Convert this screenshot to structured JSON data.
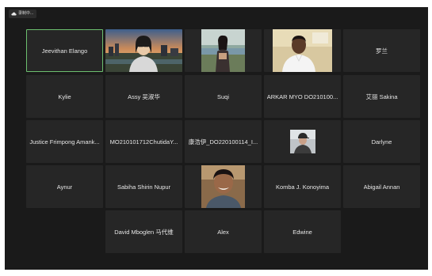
{
  "recording": {
    "label": "录制中...",
    "icon": "cloud-icon"
  },
  "colors": {
    "window_bg": "#1a1a1a",
    "tile_bg": "#262626",
    "active_speaker_border": "#6cbf6f",
    "name_text": "#e6e6e6"
  },
  "participants": [
    {
      "name": "Jeevithan Elango",
      "active": true,
      "video": false
    },
    {
      "name": "",
      "video": true,
      "video_desc": "woman-with-city-sunset-background"
    },
    {
      "name": "",
      "video": true,
      "video_desc": "person-outdoors-by-water"
    },
    {
      "name": "",
      "video": true,
      "video_desc": "man-in-white-shirt-indoors"
    },
    {
      "name": "罗兰",
      "video": false
    },
    {
      "name": "Kylie",
      "video": false
    },
    {
      "name": "Assy 吴淑华",
      "video": false
    },
    {
      "name": "Suqi",
      "video": false
    },
    {
      "name": "ARKAR MYO DO210100...",
      "video": false
    },
    {
      "name": "艾丽 Sakina",
      "video": false
    },
    {
      "name": "Justice Frimpong Amank...",
      "video": false
    },
    {
      "name": "MO210101712ChutidaY...",
      "video": false
    },
    {
      "name": "康浩伊_DO220100114_I...",
      "video": false
    },
    {
      "name": "",
      "video": true,
      "video_desc": "small-profile-photo-man-in-cap"
    },
    {
      "name": "Darlyne",
      "video": false
    },
    {
      "name": "Aynur",
      "video": false
    },
    {
      "name": "Sabiha Shirin Nupur",
      "video": false
    },
    {
      "name": "",
      "video": true,
      "video_desc": "smiling-young-man"
    },
    {
      "name": "Komba J. Konoyima",
      "video": false
    },
    {
      "name": "Abigail Annan",
      "video": false
    },
    {
      "name": "David Mboglen 马代维",
      "video": false
    },
    {
      "name": "Alex",
      "video": false
    },
    {
      "name": "Edwine",
      "video": false
    }
  ]
}
